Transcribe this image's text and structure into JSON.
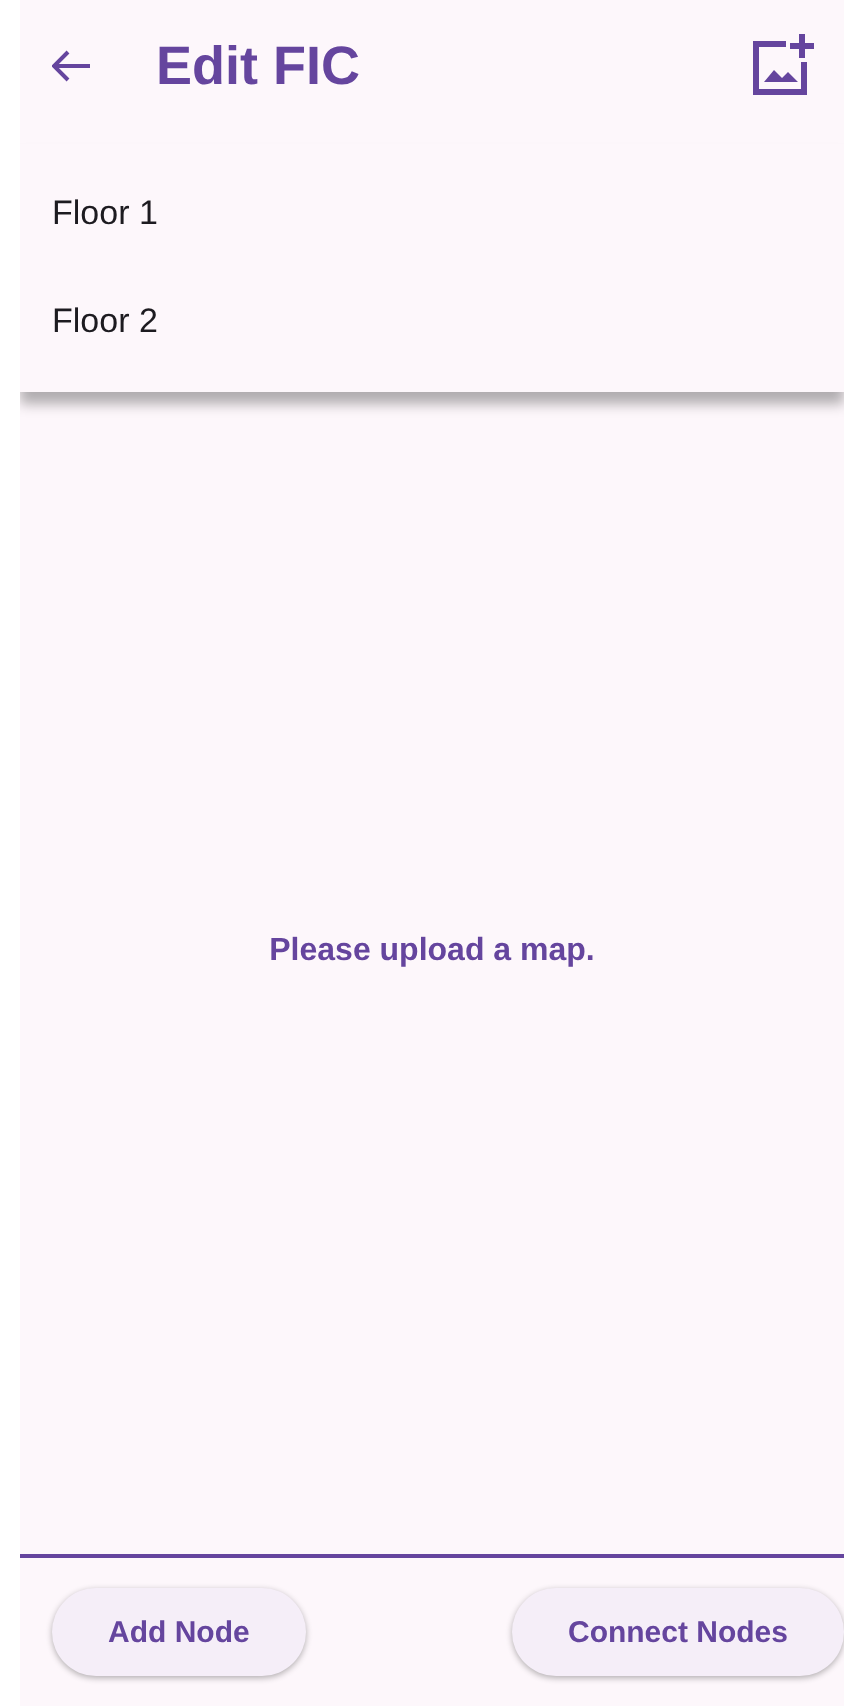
{
  "app_bar": {
    "title": "Edit FIC"
  },
  "floor_menu": {
    "items": [
      {
        "label": "Floor 1"
      },
      {
        "label": "Floor 2"
      }
    ]
  },
  "message": "Please upload a map.",
  "buttons": [
    {
      "label": "Add Node"
    },
    {
      "label": "Connect Nodes"
    }
  ]
}
